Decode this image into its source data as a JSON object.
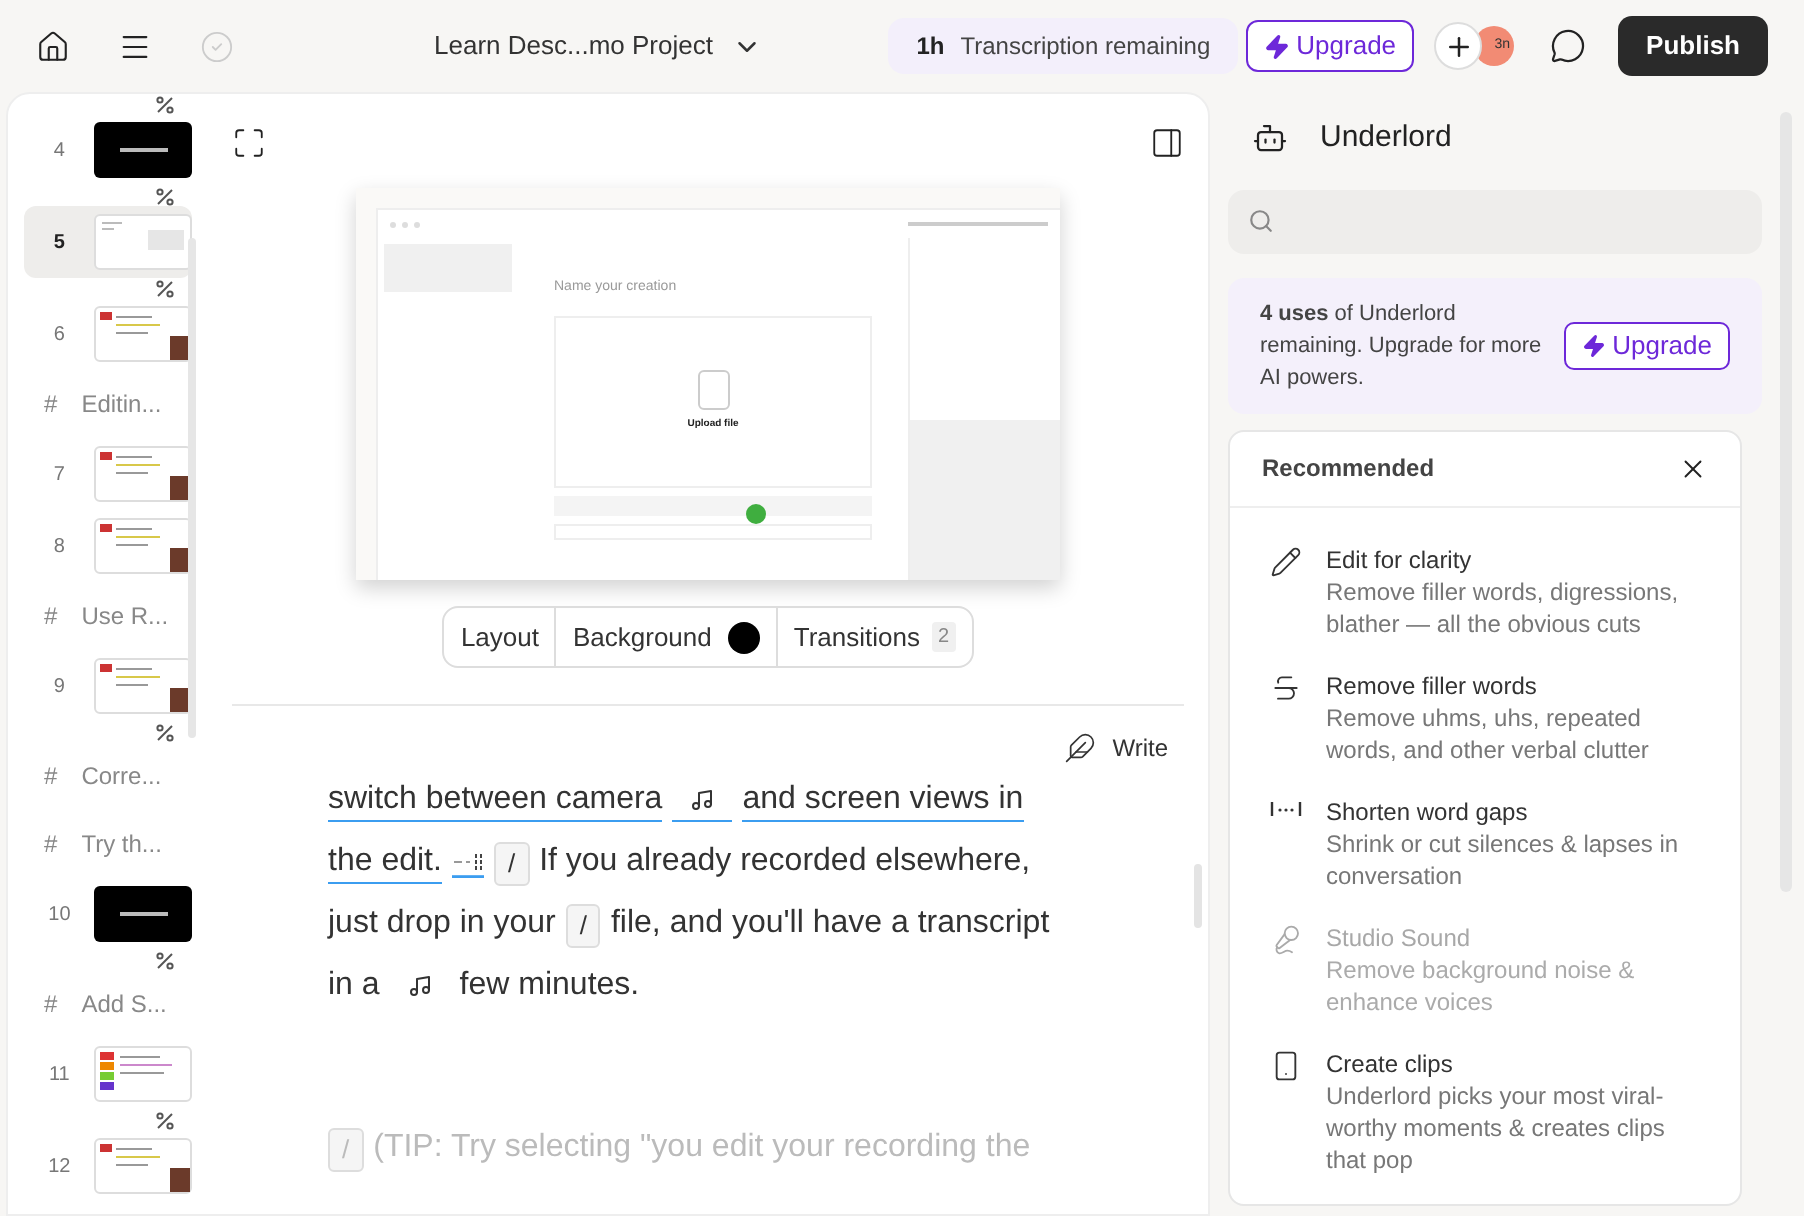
{
  "topbar": {
    "project_title": "Learn Desc...mo Project",
    "transcription": {
      "amount": "1h",
      "label": "Transcription remaining"
    },
    "upgrade": "Upgrade",
    "avatar": "3n",
    "publish": "Publish"
  },
  "scenes": [
    {
      "kind": "transition"
    },
    {
      "kind": "scene",
      "number": "4",
      "thumbnail": {
        "kind": "dark"
      },
      "selected": false
    },
    {
      "kind": "transition"
    },
    {
      "kind": "scene",
      "number": "5",
      "thumbnail": {
        "kind": "blank"
      },
      "selected": true
    },
    {
      "kind": "transition"
    },
    {
      "kind": "scene",
      "number": "6",
      "thumbnail": {
        "kind": "light"
      },
      "selected": false
    },
    {
      "kind": "heading",
      "marker": "#",
      "text": "Editin..."
    },
    {
      "kind": "scene",
      "number": "7",
      "thumbnail": {
        "kind": "light"
      },
      "selected": false
    },
    {
      "kind": "scene",
      "number": "8",
      "thumbnail": {
        "kind": "light"
      },
      "selected": false
    },
    {
      "kind": "heading",
      "marker": "#",
      "text": "Use R..."
    },
    {
      "kind": "scene",
      "number": "9",
      "thumbnail": {
        "kind": "light"
      },
      "selected": false
    },
    {
      "kind": "transition"
    },
    {
      "kind": "heading",
      "marker": "#",
      "text": "Corre..."
    },
    {
      "kind": "heading",
      "marker": "#",
      "text": "Try th..."
    },
    {
      "kind": "scene",
      "number": "10",
      "thumbnail": {
        "kind": "dark"
      },
      "selected": false
    },
    {
      "kind": "transition"
    },
    {
      "kind": "heading",
      "marker": "#",
      "text": "Add S..."
    },
    {
      "kind": "scene",
      "number": "11",
      "thumbnail": {
        "kind": "color"
      },
      "selected": false
    },
    {
      "kind": "transition"
    },
    {
      "kind": "scene",
      "number": "12",
      "thumbnail": {
        "kind": "light"
      },
      "selected": false
    }
  ],
  "preview": {
    "heading": "Name your creation",
    "upload": "Upload file"
  },
  "scene_toolbar": {
    "layout": "Layout",
    "background": {
      "label": "Background",
      "color": "#000000"
    },
    "transitions": {
      "label": "Transitions",
      "count": "2"
    }
  },
  "write_button": "Write",
  "transcript": [
    {
      "muted": false,
      "lines": [
        {
          "segments": [
            {
              "kind": "text",
              "text": "switch between camera",
              "underlined": true
            },
            {
              "kind": "note",
              "underlined": true
            },
            {
              "kind": "text",
              "text": "and screen views in",
              "underlined": true
            }
          ]
        },
        {
          "segments": [
            {
              "kind": "text",
              "text": "the edit.",
              "underlined": true
            },
            {
              "kind": "marker",
              "underlined": true
            },
            {
              "kind": "gap",
              "text": "/",
              "underlined": false
            },
            {
              "kind": "text",
              "text": "If you already recorded elsewhere,",
              "underlined": false
            }
          ]
        },
        {
          "segments": [
            {
              "kind": "text",
              "text": "just drop in your",
              "underlined": false
            },
            {
              "kind": "gap",
              "text": "/",
              "underlined": false
            },
            {
              "kind": "text",
              "text": "file, and you'll have a transcript",
              "underlined": false
            }
          ]
        },
        {
          "segments": [
            {
              "kind": "text",
              "text": "in a",
              "underlined": false
            },
            {
              "kind": "note",
              "underlined": false
            },
            {
              "kind": "text",
              "text": "few minutes.",
              "underlined": false
            }
          ]
        }
      ]
    },
    {
      "muted": true,
      "lines": [
        {
          "segments": [
            {
              "kind": "gap",
              "text": "/",
              "underlined": false
            },
            {
              "kind": "text",
              "text": "(TIP: Try selecting \"you edit your recording the",
              "underlined": false
            }
          ]
        }
      ]
    }
  ],
  "assistant": {
    "title": "Underlord",
    "banner": {
      "text": "**4 uses** of Underlord remaining. Upgrade for more AI powers.",
      "button": "Upgrade"
    },
    "recommended": {
      "title": "Recommended",
      "items": [
        {
          "kind": "pencil",
          "title": "Edit for clarity",
          "description": "Remove filler words, digressions, blather — all the obvious cuts",
          "disabled": false
        },
        {
          "kind": "strike",
          "title": "Remove filler words",
          "description": "Remove uhms, uhs, repeated words, and other verbal clutter",
          "disabled": false
        },
        {
          "kind": "gaps",
          "title": "Shorten word gaps",
          "description": "Shrink or cut silences & lapses in conversation",
          "disabled": false
        },
        {
          "kind": "mic",
          "title": "Studio Sound",
          "description": "Remove background noise & enhance voices",
          "disabled": true
        },
        {
          "kind": "clips",
          "title": "Create clips",
          "description": "Underlord picks your most viral-worthy moments & creates clips that pop",
          "disabled": false
        }
      ]
    }
  }
}
